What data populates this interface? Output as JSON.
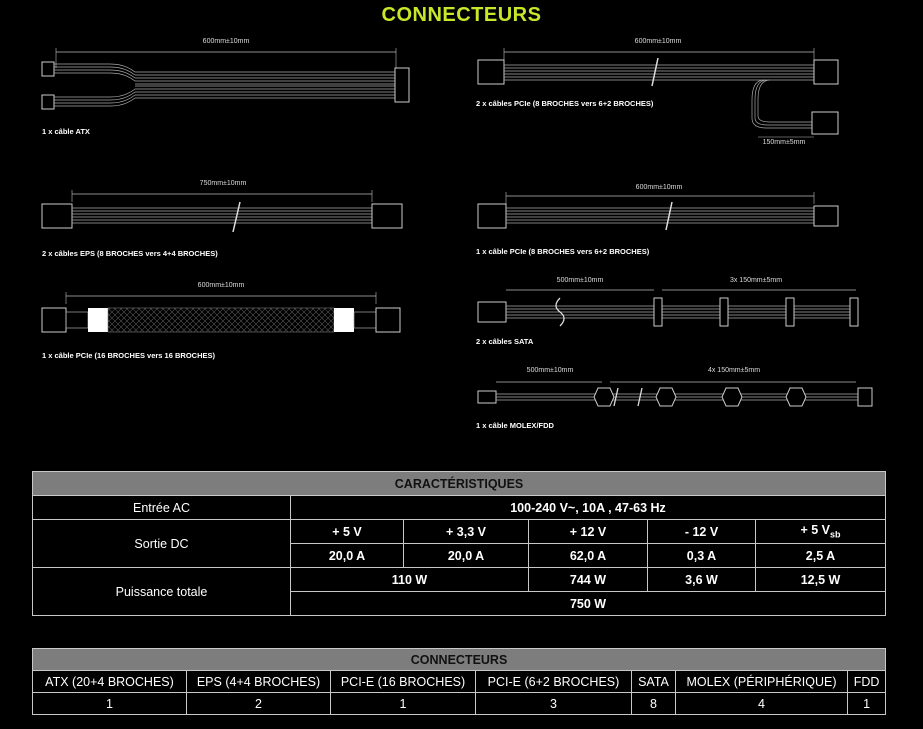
{
  "page": {
    "title": "CONNECTEURS"
  },
  "cables": {
    "atx": {
      "dimension": "600mm±10mm",
      "caption": "1 x câble ATX"
    },
    "pcie_dual": {
      "dimension": "600mm±10mm",
      "dimension2": "150mm±5mm",
      "caption": "2 x câbles PCIe (8 BROCHES vers 6+2 BROCHES)"
    },
    "eps": {
      "dimension": "750mm±10mm",
      "caption": "2 x câbles EPS (8 BROCHES vers 4+4 BROCHES)"
    },
    "pcie_single": {
      "dimension": "600mm±10mm",
      "caption": "1 x câble PCIe (8 BROCHES vers 6+2 BROCHES)"
    },
    "pcie16": {
      "dimension": "600mm±10mm",
      "caption": "1 x câble PCIe (16 BROCHES vers 16 BROCHES)"
    },
    "sata": {
      "dimension": "500mm±10mm",
      "dimension2": "3x 150mm±5mm",
      "caption": "2 x câbles SATA"
    },
    "molex": {
      "dimension": "500mm±10mm",
      "dimension2": "4x 150mm±5mm",
      "caption": "1 x câble MOLEX/FDD"
    }
  },
  "specs": {
    "header": "CARACTÉRISTIQUES",
    "ac_label": "Entrée AC",
    "ac_value": "100-240 V~, 10A , 47-63 Hz",
    "dc_label": "Sortie DC",
    "rails": [
      "+ 5 V",
      "+ 3,3 V",
      "+ 12 V",
      "- 12 V",
      "+ 5 V"
    ],
    "rail_sub": "sb",
    "currents": [
      "20,0 A",
      "20,0 A",
      "62,0 A",
      "0,3 A",
      "2,5 A"
    ],
    "power_label": "Puissance totale",
    "power_combined": "110 W",
    "power_12v": "744 W",
    "power_m12v": "3,6 W",
    "power_5vsb": "12,5 W",
    "power_total": "750 W"
  },
  "connectors": {
    "header": "CONNECTEURS",
    "columns": [
      "ATX (20+4 BROCHES)",
      "EPS (4+4 BROCHES)",
      "PCI-E (16 BROCHES)",
      "PCI-E (6+2 BROCHES)",
      "SATA",
      "MOLEX (PÉRIPHÉRIQUE)",
      "FDD"
    ],
    "counts": [
      "1",
      "2",
      "1",
      "3",
      "8",
      "4",
      "1"
    ]
  }
}
